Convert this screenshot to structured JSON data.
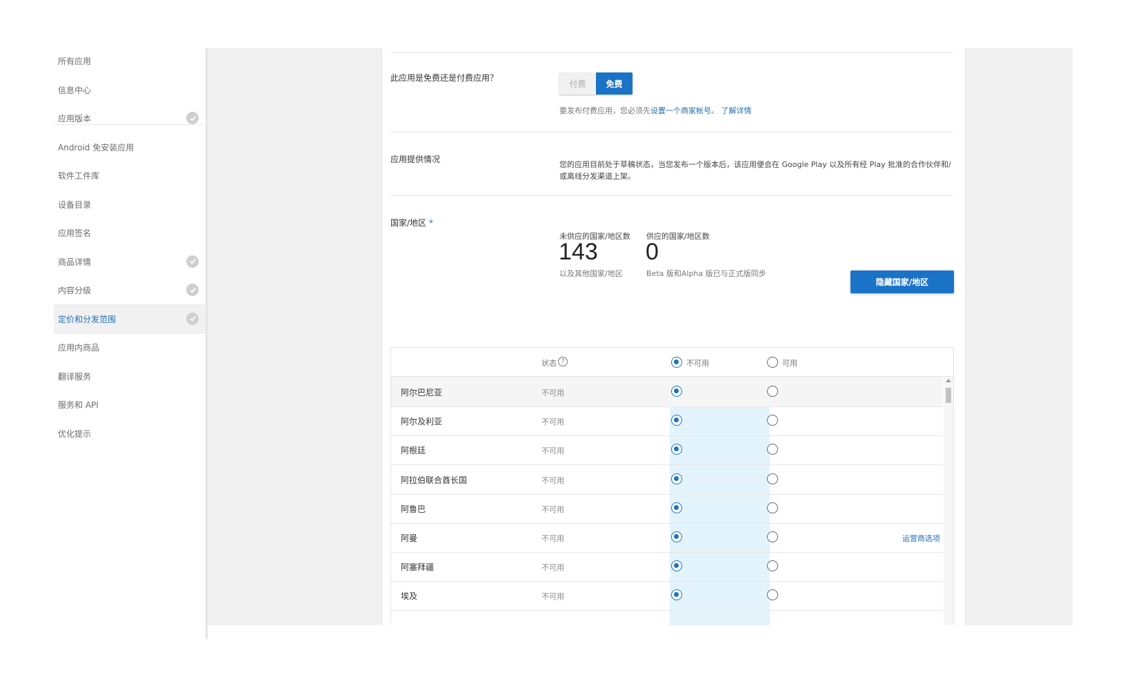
{
  "sidebar": {
    "items": [
      {
        "label": "所有应用",
        "checked": false,
        "active": false
      },
      {
        "label": "信息中心",
        "checked": false,
        "active": false
      },
      {
        "label": "应用版本",
        "checked": true,
        "active": false
      },
      {
        "label": "Android 免安装应用",
        "checked": false,
        "active": false
      },
      {
        "label": "软件工件库",
        "checked": false,
        "active": false
      },
      {
        "label": "设备目录",
        "checked": false,
        "active": false
      },
      {
        "label": "应用签名",
        "checked": false,
        "active": false
      },
      {
        "label": "商品详情",
        "checked": true,
        "active": false
      },
      {
        "label": "内容分级",
        "checked": true,
        "active": false
      },
      {
        "label": "定价和分发范围",
        "checked": true,
        "active": true
      },
      {
        "label": "应用内商品",
        "checked": false,
        "active": false
      },
      {
        "label": "翻译服务",
        "checked": false,
        "active": false
      },
      {
        "label": "服务和 API",
        "checked": false,
        "active": false
      },
      {
        "label": "优化提示",
        "checked": false,
        "active": false
      }
    ]
  },
  "pricing": {
    "question": "此应用是免费还是付费应用？",
    "paid_label": "付费",
    "free_label": "免费",
    "hint_prefix": "要发布付费应用，您必须先",
    "merchant_link": "设置一个商家帐号",
    "hint_sep": "。",
    "learn_more": "了解详情"
  },
  "offer": {
    "label": "应用提供情况",
    "text": "您的应用目前处于草稿状态，当您发布一个版本后，该应用便会在 Google Play 以及所有经 Play 批准的合作伙伴和/或离线分发渠道上架。"
  },
  "countries": {
    "label": "国家/地区",
    "required_mark": "*",
    "unavailable_caption": "未供应的国家/地区数",
    "unavailable_count": "143",
    "unavailable_sub": "以及其他国家/地区",
    "available_caption": "供应的国家/地区数",
    "available_count": "0",
    "available_sub": "Beta 版和Alpha 版已与正式版同步",
    "hide_button": "隐藏国家/地区"
  },
  "table": {
    "status_header": "状态",
    "help_glyph": "?",
    "unavailable_header": "不可用",
    "available_header": "可用",
    "rows": [
      {
        "country": "阿尔巴尼亚",
        "status": "不可用",
        "carrier": ""
      },
      {
        "country": "阿尔及利亚",
        "status": "不可用",
        "carrier": ""
      },
      {
        "country": "阿根廷",
        "status": "不可用",
        "carrier": ""
      },
      {
        "country": "阿拉伯联合酋长国",
        "status": "不可用",
        "carrier": ""
      },
      {
        "country": "阿鲁巴",
        "status": "不可用",
        "carrier": ""
      },
      {
        "country": "阿曼",
        "status": "不可用",
        "carrier": "运营商选项"
      },
      {
        "country": "阿塞拜疆",
        "status": "不可用",
        "carrier": ""
      },
      {
        "country": "埃及",
        "status": "不可用",
        "carrier": ""
      }
    ]
  }
}
